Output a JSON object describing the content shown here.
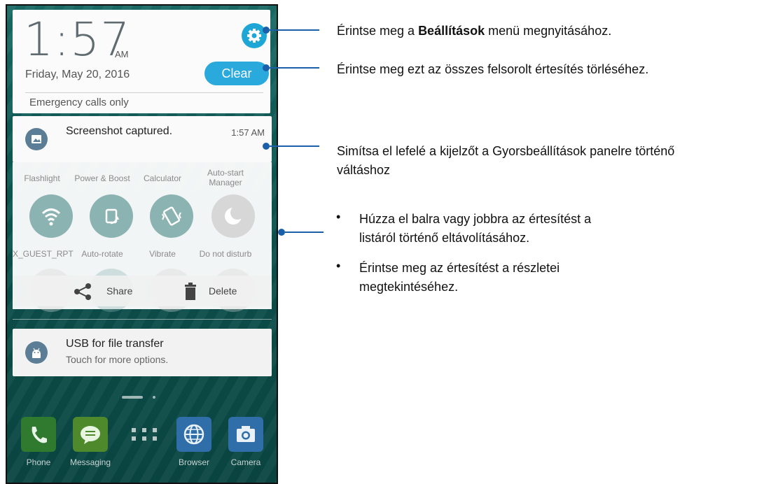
{
  "header": {
    "time": "1:57",
    "ampm": "AM",
    "date": "Friday, May 20, 2016",
    "clear_label": "Clear",
    "status": "Emergency calls only"
  },
  "notification1": {
    "title": "Screenshot captured.",
    "time": "1:57 AM"
  },
  "quick_settings": {
    "row1_labels": [
      "Flashlight",
      "Power & Boost",
      "Calculator",
      "Auto-start\nManager"
    ],
    "row2_labels": [
      "X_GUEST_RPT",
      "Auto-rotate",
      "Vibrate",
      "Do not disturb"
    ]
  },
  "actions": {
    "share": "Share",
    "delete": "Delete"
  },
  "usb": {
    "title": "USB for file transfer",
    "subtitle": "Touch for more options."
  },
  "dock": {
    "labels": [
      "Phone",
      "Messaging",
      "Browser",
      "Camera"
    ]
  },
  "annotations": {
    "settings_prefix": "Érintse meg a ",
    "settings_bold": "Beállítások",
    "settings_suffix": " menü megnyitásához.",
    "clear": "Érintse meg ezt az összes felsorolt értesítés törléséhez.",
    "swipe_line1": "Simítsa el lefelé a kijelzőt a Gyorsbeállítások panelre történő",
    "swipe_line2": "váltáshoz",
    "bullet1_line1": "Húzza el balra vagy jobbra az értesítést a",
    "bullet1_line2": "listáról történő eltávolításához.",
    "bullet2_line1": "Érintse meg az értesítést a részletei",
    "bullet2_line2": "megtekintéséhez."
  },
  "colors": {
    "accent": "#1ea7d6",
    "annotation_line": "#1a5fa8",
    "qs_active": "#8bb3b2"
  }
}
